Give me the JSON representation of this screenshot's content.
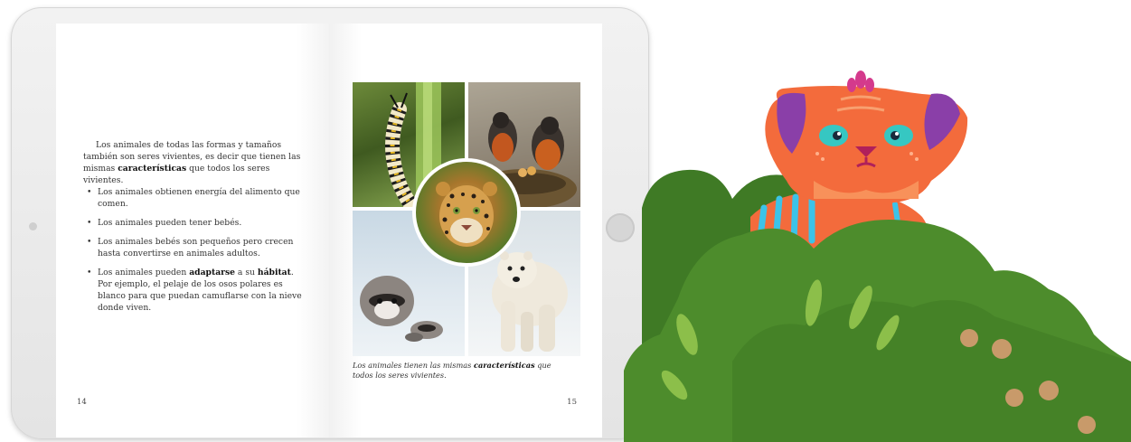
{
  "book": {
    "intro_lead": "Los animales de todas las formas y tamaños también son seres vivientes, es decir que tienen las mismas ",
    "intro_bold": "características",
    "intro_tail": " que todos los seres vivientes.",
    "bullets": {
      "b1": "Los animales obtienen energía del alimento que comen.",
      "b2": "Los animales pueden tener bebés.",
      "b3": "Los animales bebés son pequeños pero crecen hasta convertirse en animales adultos.",
      "b4_a": "Los animales pueden ",
      "b4_bold1": "adaptarse",
      "b4_b": " a su ",
      "b4_bold2": "hábitat",
      "b4_c": ". Por ejemplo, el pelaje de los osos polares es blanco para que puedan camuflarse con la nieve donde viven."
    },
    "caption_lead": "Los animales tienen las mismas ",
    "caption_bold": "características",
    "caption_tail": " que todos los seres vivientes.",
    "page_left": "14",
    "page_right": "15"
  },
  "photos": {
    "caterpillar": "caterpillar-photo",
    "robins": "robins-nest-photo",
    "jaguar": "jaguar-photo",
    "raccoon": "raccoons-photo",
    "polar_bear": "polar-bear-photo"
  },
  "colors": {
    "bush_dark": "#3f7a25",
    "bush_mid": "#4d8c2c",
    "leaf_light": "#8cbf4a",
    "creature_orange": "#f36b3c",
    "creature_ear_purple": "#8a3fa8",
    "creature_eye": "#36c7c2",
    "creature_stripe": "#3cc3e8",
    "crest_pink": "#d43a8c",
    "spots": "#c89a6a"
  }
}
